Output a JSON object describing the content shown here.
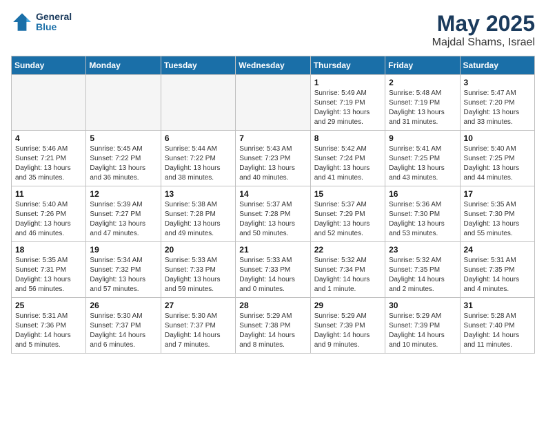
{
  "header": {
    "logo_line1": "General",
    "logo_line2": "Blue",
    "month": "May 2025",
    "location": "Majdal Shams, Israel"
  },
  "days_of_week": [
    "Sunday",
    "Monday",
    "Tuesday",
    "Wednesday",
    "Thursday",
    "Friday",
    "Saturday"
  ],
  "weeks": [
    [
      {
        "num": "",
        "detail": ""
      },
      {
        "num": "",
        "detail": ""
      },
      {
        "num": "",
        "detail": ""
      },
      {
        "num": "",
        "detail": ""
      },
      {
        "num": "1",
        "detail": "Sunrise: 5:49 AM\nSunset: 7:19 PM\nDaylight: 13 hours\nand 29 minutes."
      },
      {
        "num": "2",
        "detail": "Sunrise: 5:48 AM\nSunset: 7:19 PM\nDaylight: 13 hours\nand 31 minutes."
      },
      {
        "num": "3",
        "detail": "Sunrise: 5:47 AM\nSunset: 7:20 PM\nDaylight: 13 hours\nand 33 minutes."
      }
    ],
    [
      {
        "num": "4",
        "detail": "Sunrise: 5:46 AM\nSunset: 7:21 PM\nDaylight: 13 hours\nand 35 minutes."
      },
      {
        "num": "5",
        "detail": "Sunrise: 5:45 AM\nSunset: 7:22 PM\nDaylight: 13 hours\nand 36 minutes."
      },
      {
        "num": "6",
        "detail": "Sunrise: 5:44 AM\nSunset: 7:22 PM\nDaylight: 13 hours\nand 38 minutes."
      },
      {
        "num": "7",
        "detail": "Sunrise: 5:43 AM\nSunset: 7:23 PM\nDaylight: 13 hours\nand 40 minutes."
      },
      {
        "num": "8",
        "detail": "Sunrise: 5:42 AM\nSunset: 7:24 PM\nDaylight: 13 hours\nand 41 minutes."
      },
      {
        "num": "9",
        "detail": "Sunrise: 5:41 AM\nSunset: 7:25 PM\nDaylight: 13 hours\nand 43 minutes."
      },
      {
        "num": "10",
        "detail": "Sunrise: 5:40 AM\nSunset: 7:25 PM\nDaylight: 13 hours\nand 44 minutes."
      }
    ],
    [
      {
        "num": "11",
        "detail": "Sunrise: 5:40 AM\nSunset: 7:26 PM\nDaylight: 13 hours\nand 46 minutes."
      },
      {
        "num": "12",
        "detail": "Sunrise: 5:39 AM\nSunset: 7:27 PM\nDaylight: 13 hours\nand 47 minutes."
      },
      {
        "num": "13",
        "detail": "Sunrise: 5:38 AM\nSunset: 7:28 PM\nDaylight: 13 hours\nand 49 minutes."
      },
      {
        "num": "14",
        "detail": "Sunrise: 5:37 AM\nSunset: 7:28 PM\nDaylight: 13 hours\nand 50 minutes."
      },
      {
        "num": "15",
        "detail": "Sunrise: 5:37 AM\nSunset: 7:29 PM\nDaylight: 13 hours\nand 52 minutes."
      },
      {
        "num": "16",
        "detail": "Sunrise: 5:36 AM\nSunset: 7:30 PM\nDaylight: 13 hours\nand 53 minutes."
      },
      {
        "num": "17",
        "detail": "Sunrise: 5:35 AM\nSunset: 7:30 PM\nDaylight: 13 hours\nand 55 minutes."
      }
    ],
    [
      {
        "num": "18",
        "detail": "Sunrise: 5:35 AM\nSunset: 7:31 PM\nDaylight: 13 hours\nand 56 minutes."
      },
      {
        "num": "19",
        "detail": "Sunrise: 5:34 AM\nSunset: 7:32 PM\nDaylight: 13 hours\nand 57 minutes."
      },
      {
        "num": "20",
        "detail": "Sunrise: 5:33 AM\nSunset: 7:33 PM\nDaylight: 13 hours\nand 59 minutes."
      },
      {
        "num": "21",
        "detail": "Sunrise: 5:33 AM\nSunset: 7:33 PM\nDaylight: 14 hours\nand 0 minutes."
      },
      {
        "num": "22",
        "detail": "Sunrise: 5:32 AM\nSunset: 7:34 PM\nDaylight: 14 hours\nand 1 minute."
      },
      {
        "num": "23",
        "detail": "Sunrise: 5:32 AM\nSunset: 7:35 PM\nDaylight: 14 hours\nand 2 minutes."
      },
      {
        "num": "24",
        "detail": "Sunrise: 5:31 AM\nSunset: 7:35 PM\nDaylight: 14 hours\nand 4 minutes."
      }
    ],
    [
      {
        "num": "25",
        "detail": "Sunrise: 5:31 AM\nSunset: 7:36 PM\nDaylight: 14 hours\nand 5 minutes."
      },
      {
        "num": "26",
        "detail": "Sunrise: 5:30 AM\nSunset: 7:37 PM\nDaylight: 14 hours\nand 6 minutes."
      },
      {
        "num": "27",
        "detail": "Sunrise: 5:30 AM\nSunset: 7:37 PM\nDaylight: 14 hours\nand 7 minutes."
      },
      {
        "num": "28",
        "detail": "Sunrise: 5:29 AM\nSunset: 7:38 PM\nDaylight: 14 hours\nand 8 minutes."
      },
      {
        "num": "29",
        "detail": "Sunrise: 5:29 AM\nSunset: 7:39 PM\nDaylight: 14 hours\nand 9 minutes."
      },
      {
        "num": "30",
        "detail": "Sunrise: 5:29 AM\nSunset: 7:39 PM\nDaylight: 14 hours\nand 10 minutes."
      },
      {
        "num": "31",
        "detail": "Sunrise: 5:28 AM\nSunset: 7:40 PM\nDaylight: 14 hours\nand 11 minutes."
      }
    ]
  ]
}
